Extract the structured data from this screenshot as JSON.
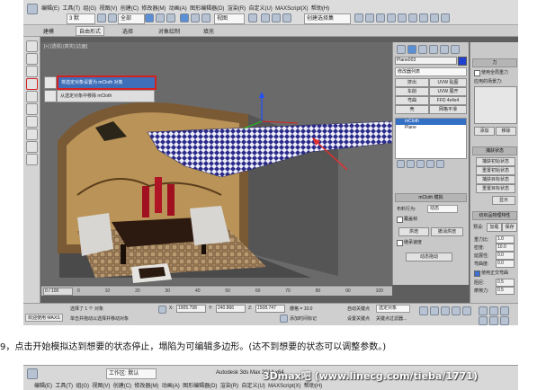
{
  "titlebar": {
    "workspace_label": "3 默",
    "menus": [
      "编辑(E)",
      "工具(T)",
      "组(G)",
      "视图(V)",
      "创建(C)",
      "修改器(M)",
      "动画(A)",
      "图形编辑器(D)",
      "渲染(R)",
      "自定义(U)",
      "MAXScript(X)",
      "帮助(H)"
    ],
    "selection_dropdown": "全部",
    "view_dropdown": "视图",
    "named_sets_dropdown": "创建选择集"
  },
  "ribbon": {
    "tabs": [
      "建模",
      "自由形式",
      "选择",
      "对象绘制",
      "填充"
    ],
    "active_tab": "自由形式"
  },
  "viewport": {
    "label": "[+] [透视] [真实] [边面]",
    "flyout": {
      "item1": "将选定对象设置为 mCloth 对象",
      "item2": "从选定对象中移除 mCloth"
    }
  },
  "command_panel": {
    "object_name": "Plane003",
    "modifier_list": "修改器列表",
    "buttons": [
      [
        "挤出",
        "UVW 贴图"
      ],
      [
        "车削",
        "UVW 展开"
      ],
      [
        "弯曲",
        "FFD 4x4x4"
      ],
      [
        "壳",
        "网格平滑"
      ]
    ],
    "stack": [
      "mCloth",
      "Plane"
    ],
    "mcloth_rollout": "mCloth 模拟",
    "cloth_behavior_label": "布料行为:",
    "cloth_behavior_value": "动态",
    "override_label": "覆盖帧",
    "bake_label": "烘焙",
    "undo_bake_label": "撤消烘焙",
    "continuity_label": "继承速度",
    "sim_local_label": "动态拖动"
  },
  "force_panel": {
    "header": "力",
    "use_gravity": "使用全局重力",
    "applied_fields": "应用的场景力:",
    "add_label": "添加",
    "remove_label": "移除",
    "capture_header": "捕获状态",
    "capture_buttons": [
      "捕获初始状态",
      "重置初始状态",
      "捕获目标状态",
      "重置目标状态"
    ],
    "show_label": "显示",
    "physical_header": "纺织品物理特性",
    "preset_label": "预设:",
    "load_label": "加载",
    "save_label": "保存",
    "params": [
      {
        "label": "重力比:",
        "value": "1.0"
      },
      {
        "label": "密度:",
        "value": "10.0"
      },
      {
        "label": "延展性:",
        "value": "0.0"
      },
      {
        "label": "弯曲度:",
        "value": "0.0"
      }
    ],
    "ortho_label": "使用正交弯曲",
    "damping": [
      {
        "label": "阻尼:",
        "value": "0.5"
      },
      {
        "label": "摩擦力:",
        "value": "0.5"
      }
    ]
  },
  "timeline": {
    "frame": "0 / 100",
    "ticks": [
      "0",
      "10",
      "20",
      "30",
      "40",
      "50",
      "60",
      "70",
      "80",
      "90",
      "100"
    ]
  },
  "statusbar": {
    "selected": "选择了 1 个 对象",
    "hint": "单击并拖动以选择并移动对象",
    "welcome": "欢迎使用 MAXS",
    "x_label": "X:",
    "x_value": "1905.798",
    "y_label": "Y:",
    "y_value": "240.866",
    "z_label": "Z:",
    "z_value": "1508.747",
    "grid": "栅格 = 10.0",
    "autokey": "自动关键点",
    "setkey": "设置关键点",
    "selected_dd": "选定对象",
    "key_filters": "关键点过滤器...",
    "add_time_tag": "添加时间标记"
  },
  "caption": "9，点击开始模拟达到想要的状态停止，塌陷为可编辑多边形。(达不到想要的状态可以调整参数。)",
  "bottom_strip": {
    "workspace": "工作区: 默认",
    "title": "Autodesk 3ds Max 2014 x64",
    "file": "3Dmax1B...",
    "watermark": "3Dmax吧 (www.linecg.com/tieba/1771)",
    "menus": [
      "编辑(E)",
      "工具(T)",
      "组(G)",
      "视图(V)",
      "创建(C)",
      "修改器(M)",
      "动画(A)",
      "图形编辑器(D)",
      "渲染(R)",
      "自定义(U)",
      "MAXScript(X)",
      "帮助(H)"
    ]
  },
  "colors": {
    "highlight_border": "#d42020",
    "selection_blue": "#3f6fb9",
    "viewport_bg": "#6a6a6a",
    "arrow": "#e03030"
  }
}
